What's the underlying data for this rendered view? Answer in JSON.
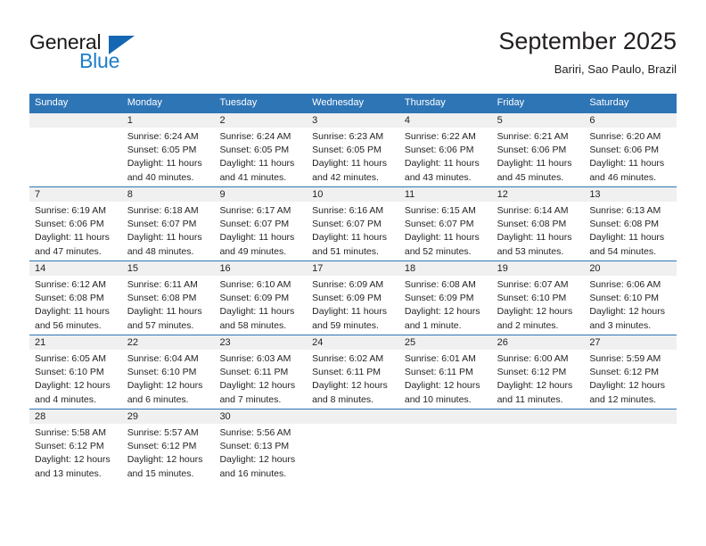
{
  "logo": {
    "word_top": "General",
    "word_bottom": "Blue",
    "triangle_icon": "triangle-icon",
    "brand_color": "#1f7dc7",
    "triangle_color": "#1567b3"
  },
  "header": {
    "title": "September 2025",
    "subtitle": "Bariri, Sao Paulo, Brazil"
  },
  "theme": {
    "header_bg": "#2e75b6",
    "header_text": "#ffffff",
    "date_band_bg": "#f0f0f0",
    "body_text": "#231f20",
    "rule_color": "#2e75b6"
  },
  "weekday_headers": [
    "Sunday",
    "Monday",
    "Tuesday",
    "Wednesday",
    "Thursday",
    "Friday",
    "Saturday"
  ],
  "weeks": [
    {
      "days": [
        {
          "num": "",
          "sunrise": "",
          "sunset": "",
          "daylight_line1": "",
          "daylight_line2": ""
        },
        {
          "num": "1",
          "sunrise": "Sunrise: 6:24 AM",
          "sunset": "Sunset: 6:05 PM",
          "daylight_line1": "Daylight: 11 hours",
          "daylight_line2": "and 40 minutes."
        },
        {
          "num": "2",
          "sunrise": "Sunrise: 6:24 AM",
          "sunset": "Sunset: 6:05 PM",
          "daylight_line1": "Daylight: 11 hours",
          "daylight_line2": "and 41 minutes."
        },
        {
          "num": "3",
          "sunrise": "Sunrise: 6:23 AM",
          "sunset": "Sunset: 6:05 PM",
          "daylight_line1": "Daylight: 11 hours",
          "daylight_line2": "and 42 minutes."
        },
        {
          "num": "4",
          "sunrise": "Sunrise: 6:22 AM",
          "sunset": "Sunset: 6:06 PM",
          "daylight_line1": "Daylight: 11 hours",
          "daylight_line2": "and 43 minutes."
        },
        {
          "num": "5",
          "sunrise": "Sunrise: 6:21 AM",
          "sunset": "Sunset: 6:06 PM",
          "daylight_line1": "Daylight: 11 hours",
          "daylight_line2": "and 45 minutes."
        },
        {
          "num": "6",
          "sunrise": "Sunrise: 6:20 AM",
          "sunset": "Sunset: 6:06 PM",
          "daylight_line1": "Daylight: 11 hours",
          "daylight_line2": "and 46 minutes."
        }
      ]
    },
    {
      "days": [
        {
          "num": "7",
          "sunrise": "Sunrise: 6:19 AM",
          "sunset": "Sunset: 6:06 PM",
          "daylight_line1": "Daylight: 11 hours",
          "daylight_line2": "and 47 minutes."
        },
        {
          "num": "8",
          "sunrise": "Sunrise: 6:18 AM",
          "sunset": "Sunset: 6:07 PM",
          "daylight_line1": "Daylight: 11 hours",
          "daylight_line2": "and 48 minutes."
        },
        {
          "num": "9",
          "sunrise": "Sunrise: 6:17 AM",
          "sunset": "Sunset: 6:07 PM",
          "daylight_line1": "Daylight: 11 hours",
          "daylight_line2": "and 49 minutes."
        },
        {
          "num": "10",
          "sunrise": "Sunrise: 6:16 AM",
          "sunset": "Sunset: 6:07 PM",
          "daylight_line1": "Daylight: 11 hours",
          "daylight_line2": "and 51 minutes."
        },
        {
          "num": "11",
          "sunrise": "Sunrise: 6:15 AM",
          "sunset": "Sunset: 6:07 PM",
          "daylight_line1": "Daylight: 11 hours",
          "daylight_line2": "and 52 minutes."
        },
        {
          "num": "12",
          "sunrise": "Sunrise: 6:14 AM",
          "sunset": "Sunset: 6:08 PM",
          "daylight_line1": "Daylight: 11 hours",
          "daylight_line2": "and 53 minutes."
        },
        {
          "num": "13",
          "sunrise": "Sunrise: 6:13 AM",
          "sunset": "Sunset: 6:08 PM",
          "daylight_line1": "Daylight: 11 hours",
          "daylight_line2": "and 54 minutes."
        }
      ]
    },
    {
      "days": [
        {
          "num": "14",
          "sunrise": "Sunrise: 6:12 AM",
          "sunset": "Sunset: 6:08 PM",
          "daylight_line1": "Daylight: 11 hours",
          "daylight_line2": "and 56 minutes."
        },
        {
          "num": "15",
          "sunrise": "Sunrise: 6:11 AM",
          "sunset": "Sunset: 6:08 PM",
          "daylight_line1": "Daylight: 11 hours",
          "daylight_line2": "and 57 minutes."
        },
        {
          "num": "16",
          "sunrise": "Sunrise: 6:10 AM",
          "sunset": "Sunset: 6:09 PM",
          "daylight_line1": "Daylight: 11 hours",
          "daylight_line2": "and 58 minutes."
        },
        {
          "num": "17",
          "sunrise": "Sunrise: 6:09 AM",
          "sunset": "Sunset: 6:09 PM",
          "daylight_line1": "Daylight: 11 hours",
          "daylight_line2": "and 59 minutes."
        },
        {
          "num": "18",
          "sunrise": "Sunrise: 6:08 AM",
          "sunset": "Sunset: 6:09 PM",
          "daylight_line1": "Daylight: 12 hours",
          "daylight_line2": "and 1 minute."
        },
        {
          "num": "19",
          "sunrise": "Sunrise: 6:07 AM",
          "sunset": "Sunset: 6:10 PM",
          "daylight_line1": "Daylight: 12 hours",
          "daylight_line2": "and 2 minutes."
        },
        {
          "num": "20",
          "sunrise": "Sunrise: 6:06 AM",
          "sunset": "Sunset: 6:10 PM",
          "daylight_line1": "Daylight: 12 hours",
          "daylight_line2": "and 3 minutes."
        }
      ]
    },
    {
      "days": [
        {
          "num": "21",
          "sunrise": "Sunrise: 6:05 AM",
          "sunset": "Sunset: 6:10 PM",
          "daylight_line1": "Daylight: 12 hours",
          "daylight_line2": "and 4 minutes."
        },
        {
          "num": "22",
          "sunrise": "Sunrise: 6:04 AM",
          "sunset": "Sunset: 6:10 PM",
          "daylight_line1": "Daylight: 12 hours",
          "daylight_line2": "and 6 minutes."
        },
        {
          "num": "23",
          "sunrise": "Sunrise: 6:03 AM",
          "sunset": "Sunset: 6:11 PM",
          "daylight_line1": "Daylight: 12 hours",
          "daylight_line2": "and 7 minutes."
        },
        {
          "num": "24",
          "sunrise": "Sunrise: 6:02 AM",
          "sunset": "Sunset: 6:11 PM",
          "daylight_line1": "Daylight: 12 hours",
          "daylight_line2": "and 8 minutes."
        },
        {
          "num": "25",
          "sunrise": "Sunrise: 6:01 AM",
          "sunset": "Sunset: 6:11 PM",
          "daylight_line1": "Daylight: 12 hours",
          "daylight_line2": "and 10 minutes."
        },
        {
          "num": "26",
          "sunrise": "Sunrise: 6:00 AM",
          "sunset": "Sunset: 6:12 PM",
          "daylight_line1": "Daylight: 12 hours",
          "daylight_line2": "and 11 minutes."
        },
        {
          "num": "27",
          "sunrise": "Sunrise: 5:59 AM",
          "sunset": "Sunset: 6:12 PM",
          "daylight_line1": "Daylight: 12 hours",
          "daylight_line2": "and 12 minutes."
        }
      ]
    },
    {
      "days": [
        {
          "num": "28",
          "sunrise": "Sunrise: 5:58 AM",
          "sunset": "Sunset: 6:12 PM",
          "daylight_line1": "Daylight: 12 hours",
          "daylight_line2": "and 13 minutes."
        },
        {
          "num": "29",
          "sunrise": "Sunrise: 5:57 AM",
          "sunset": "Sunset: 6:12 PM",
          "daylight_line1": "Daylight: 12 hours",
          "daylight_line2": "and 15 minutes."
        },
        {
          "num": "30",
          "sunrise": "Sunrise: 5:56 AM",
          "sunset": "Sunset: 6:13 PM",
          "daylight_line1": "Daylight: 12 hours",
          "daylight_line2": "and 16 minutes."
        },
        {
          "num": "",
          "sunrise": "",
          "sunset": "",
          "daylight_line1": "",
          "daylight_line2": ""
        },
        {
          "num": "",
          "sunrise": "",
          "sunset": "",
          "daylight_line1": "",
          "daylight_line2": ""
        },
        {
          "num": "",
          "sunrise": "",
          "sunset": "",
          "daylight_line1": "",
          "daylight_line2": ""
        },
        {
          "num": "",
          "sunrise": "",
          "sunset": "",
          "daylight_line1": "",
          "daylight_line2": ""
        }
      ]
    }
  ]
}
